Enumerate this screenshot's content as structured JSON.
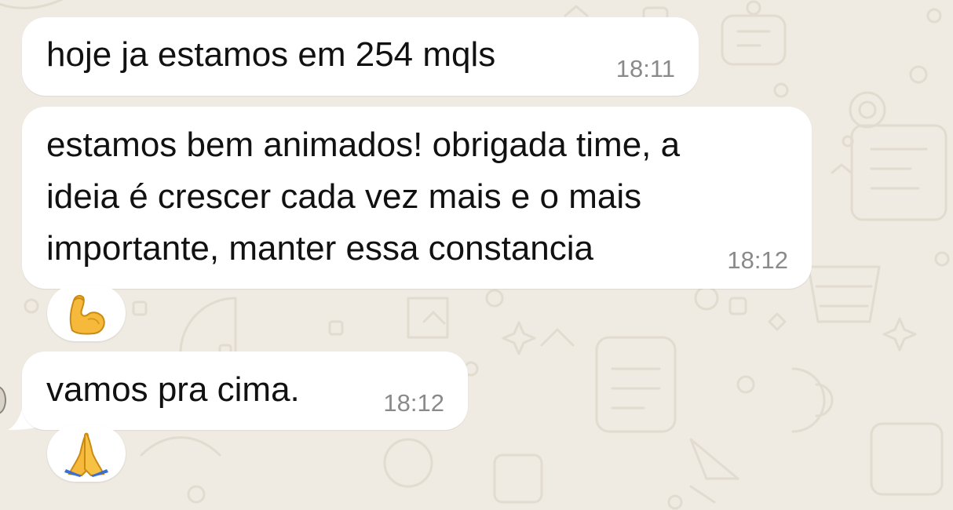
{
  "chat": {
    "messages": [
      {
        "text": "hoje ja estamos em 254 mqls",
        "time": "18:11"
      },
      {
        "text": "estamos bem animados! obrigada time, a\nideia é crescer cada vez mais e o mais\nimportante, manter essa constancia",
        "time": "18:12",
        "reaction": "flexed-biceps-emoji"
      },
      {
        "text": "vamos pra cima.",
        "time": "18:12",
        "reaction": "folded-hands-emoji"
      }
    ]
  },
  "colors": {
    "background": "#efeae2",
    "bubble": "#ffffff",
    "text": "#111111",
    "timestamp": "#8a8a8a"
  }
}
